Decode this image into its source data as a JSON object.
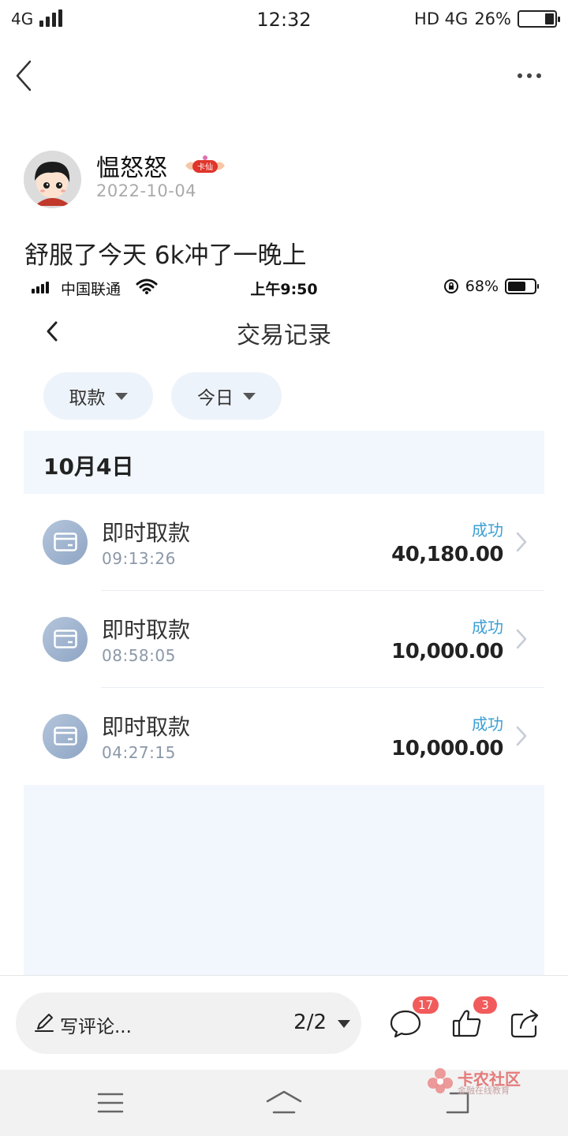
{
  "status_bar": {
    "network": "4G",
    "time": "12:32",
    "right_text": "HD 4G",
    "battery": "26%",
    "battery_level": 0.26
  },
  "nav": {
    "back_icon": "chevron-left-icon",
    "more_icon": "more-horizontal-icon"
  },
  "post": {
    "author": "愠怒怒",
    "badge_text": "卡仙",
    "date": "2022-10-04",
    "text": "舒服了今天 6k冲了一晚上"
  },
  "screenshot": {
    "status": {
      "carrier": "中国联通",
      "time": "上午9:50",
      "battery": "68%",
      "battery_level": 0.68
    },
    "title": "交易记录",
    "filters": [
      {
        "label": "取款"
      },
      {
        "label": "今日"
      }
    ],
    "date_header": "10月4日",
    "transactions": [
      {
        "title": "即时取款",
        "time": "09:13:26",
        "status": "成功",
        "amount": "40,180.00"
      },
      {
        "title": "即时取款",
        "time": "08:58:05",
        "status": "成功",
        "amount": "10,000.00"
      },
      {
        "title": "即时取款",
        "time": "04:27:15",
        "status": "成功",
        "amount": "10,000.00"
      }
    ]
  },
  "action_bar": {
    "comment_placeholder": "写评论...",
    "page_indicator": "2/2",
    "comment_count": "17",
    "like_count": "3",
    "badge_color": "#f25b5b"
  },
  "watermark": {
    "title": "卡农社区",
    "subtitle": "金融在线教育"
  }
}
